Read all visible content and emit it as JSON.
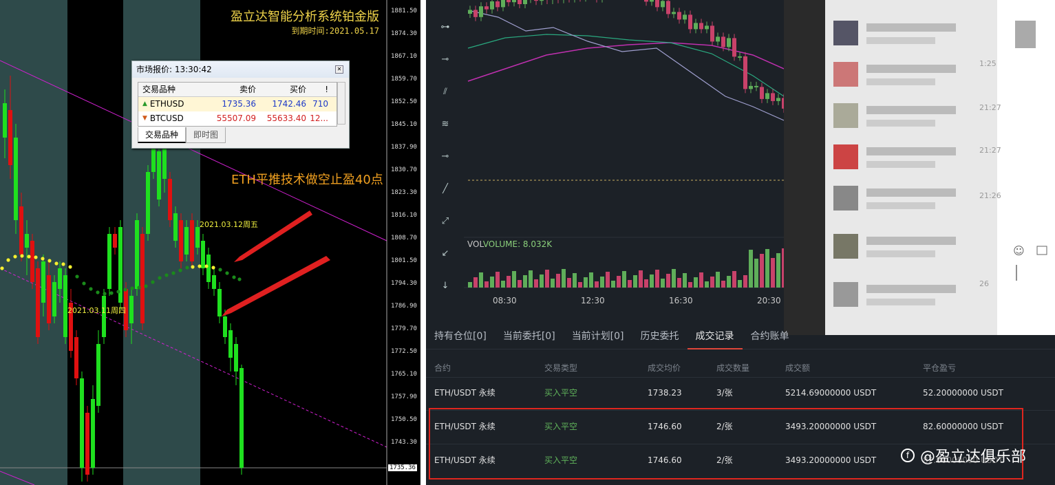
{
  "mt4": {
    "title": "盈立达智能分析系统铂金版",
    "expire": "到期时间:2021.05.17",
    "note": "ETH平推技术做空止盈40点",
    "date_note_1": "2021.03.12周五",
    "date_note_2": "2021.03.11周四",
    "price_axis": [
      "1881.50",
      "1874.30",
      "1867.10",
      "1859.70",
      "1852.50",
      "1845.10",
      "1837.90",
      "1830.70",
      "1823.30",
      "1816.10",
      "1808.70",
      "1801.50",
      "1794.30",
      "1786.90",
      "1779.70",
      "1772.50",
      "1765.10",
      "1757.90",
      "1750.50",
      "1743.30"
    ],
    "current_price": "1735.36",
    "colors": {
      "bull": "#1fe01f",
      "bear": "#e01010",
      "band": "#2e4a4a",
      "trend": "#d020d0",
      "dots": "#f5f030"
    }
  },
  "quote": {
    "title": "市场报价: 13:30:42",
    "headers": {
      "symbol": "交易品种",
      "bid": "卖价",
      "ask": "买价",
      "flag": "!"
    },
    "rows": [
      {
        "symbol": "ETHUSD",
        "bid": "1735.36",
        "ask": "1742.46",
        "spread": "710",
        "icon": "up-arrow-icon"
      },
      {
        "symbol": "BTCUSD",
        "bid": "55507.09",
        "ask": "55633.40",
        "spread": "12...",
        "icon": "down-arrow-icon"
      }
    ],
    "tabs": [
      "交易品种",
      "即时图"
    ]
  },
  "exchange": {
    "volume_label": "VOL",
    "volume_value": "VOLUME: 8.032K",
    "time_labels": [
      "08:30",
      "12:30",
      "16:30",
      "20:30"
    ],
    "tabs": [
      "持有仓位[0]",
      "当前委托[0]",
      "当前计划[0]",
      "历史委托",
      "成交记录",
      "合约账单"
    ],
    "active_tab": "成交记录",
    "table_headers": [
      "合约",
      "交易类型",
      "成交均价",
      "成交数量",
      "成交额",
      "平仓盈亏"
    ],
    "rows": [
      {
        "contract": "ETH/USDT 永续",
        "type": "买入平空",
        "price": "1738.23",
        "qty": "3/张",
        "amount": "5214.69000000 USDT",
        "pnl": "52.20000000 USDT"
      },
      {
        "contract": "ETH/USDT 永续",
        "type": "买入平空",
        "price": "1746.60",
        "qty": "2/张",
        "amount": "3493.20000000 USDT",
        "pnl": "82.60000000 USDT"
      },
      {
        "contract": "ETH/USDT 永续",
        "type": "买入平空",
        "price": "1746.60",
        "qty": "2/张",
        "amount": "3493.20000000 USDT",
        "pnl": "82.60000000 USDT"
      }
    ],
    "blurred_times": [
      "1:25",
      "21:27",
      "21:27",
      "21:26",
      "26"
    ],
    "watermark": "@盈立达俱乐部",
    "colors": {
      "bull": "#5fae5a",
      "bear": "#c8426a",
      "background": "#1c2127",
      "accent": "#e0463a"
    }
  }
}
